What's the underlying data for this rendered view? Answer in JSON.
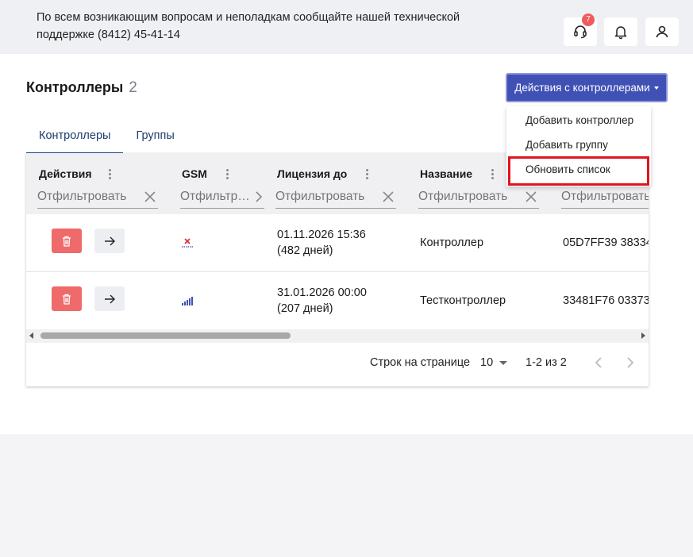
{
  "header": {
    "support_text": "По всем возникающим вопросам и неполадкам сообщайте нашей технической поддержке (8412) 45-41-14",
    "support_badge": "7",
    "icons": [
      "support-headset-icon",
      "bell-icon",
      "user-icon"
    ]
  },
  "page": {
    "title": "Контроллеры",
    "count": "2",
    "actions_button": "Действия с контроллерами"
  },
  "dropdown": {
    "items": [
      "Добавить контроллер",
      "Добавить группу",
      "Обновить список"
    ]
  },
  "tabs": [
    {
      "label": "Контроллеры",
      "active": true
    },
    {
      "label": "Группы",
      "active": false
    }
  ],
  "table": {
    "columns": [
      "Действия",
      "GSM",
      "Лицензия до",
      "Название"
    ],
    "filter_placeholders": [
      "Отфильтровать",
      "Отфильтровать",
      "Отфильтровать",
      "Отфильтровать",
      "Отфильтровать"
    ],
    "rows": [
      {
        "gsm": "no-signal",
        "license_date": "01.11.2026 15:36",
        "license_days": "(482 дней)",
        "name": "Контроллер",
        "serial": "05D7FF39 38334"
      },
      {
        "gsm": "signal",
        "license_date": "31.01.2026 00:00",
        "license_days": "(207 дней)",
        "name": "Тестконтроллер",
        "serial": "33481F76 03373"
      }
    ]
  },
  "pagination": {
    "rows_per_page_label": "Строк на странице",
    "rows_per_page": "10",
    "range": "1-2 из 2"
  },
  "colors": {
    "primary": "#3f51b5",
    "delete": "#ef6b6b",
    "highlight": "#e0141e",
    "badge": "#ef5b5b"
  }
}
